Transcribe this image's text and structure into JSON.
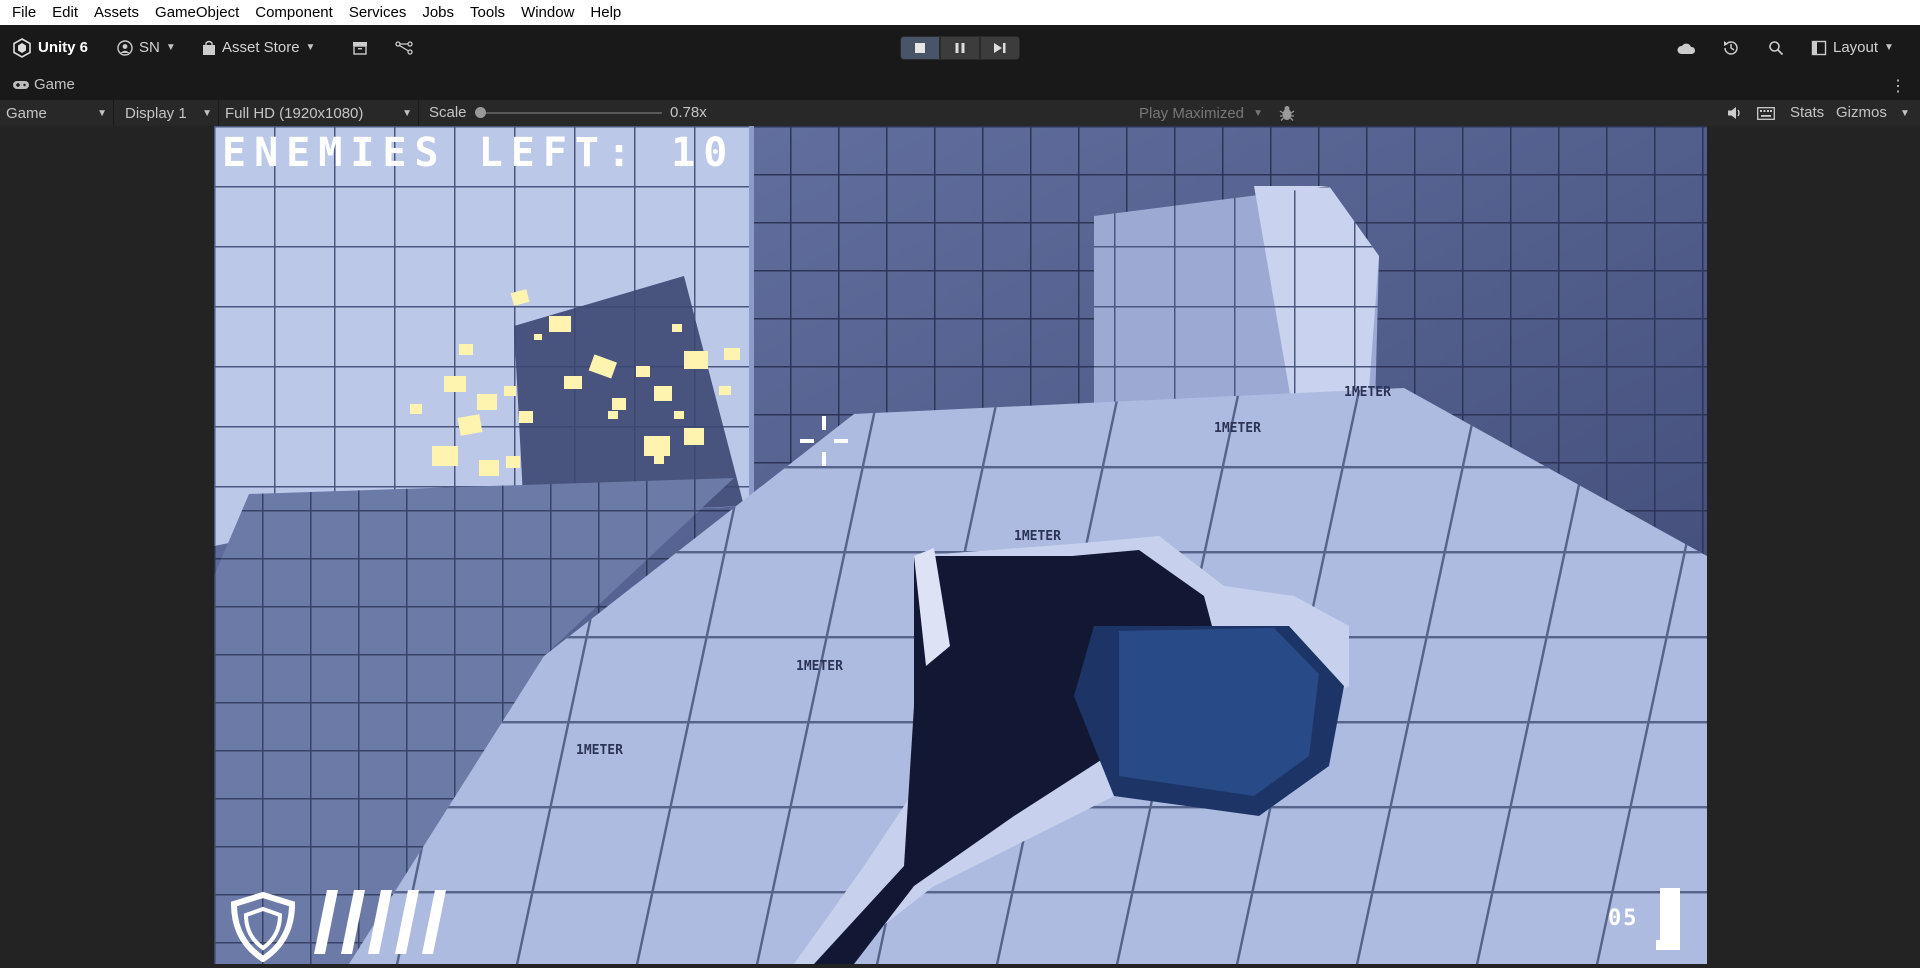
{
  "menu": [
    "File",
    "Edit",
    "Assets",
    "GameObject",
    "Component",
    "Services",
    "Jobs",
    "Tools",
    "Window",
    "Help"
  ],
  "toolbar": {
    "app_label": "Unity 6",
    "account_label": "SN",
    "asset_store_label": "Asset Store",
    "layout_label": "Layout"
  },
  "tab": {
    "label": "Game"
  },
  "game_view": {
    "mode": "Game",
    "display": "Display 1",
    "resolution": "Full HD (1920x1080)",
    "scale_label": "Scale",
    "scale_value": "0.78x",
    "play_mode": "Play Maximized",
    "stats_label": "Stats",
    "gizmos_label": "Gizmos"
  },
  "hud": {
    "enemies_left": "ENEMIES LEFT: 10",
    "ammo": "05"
  },
  "scene_decals": [
    "1METER",
    "1METER",
    "1METER",
    "1METER",
    "1METER"
  ],
  "colors": {
    "accent_play": "#4a5468",
    "sky": "#4a5688",
    "floor": "#aebbe0",
    "particle": "#fff3b0"
  }
}
